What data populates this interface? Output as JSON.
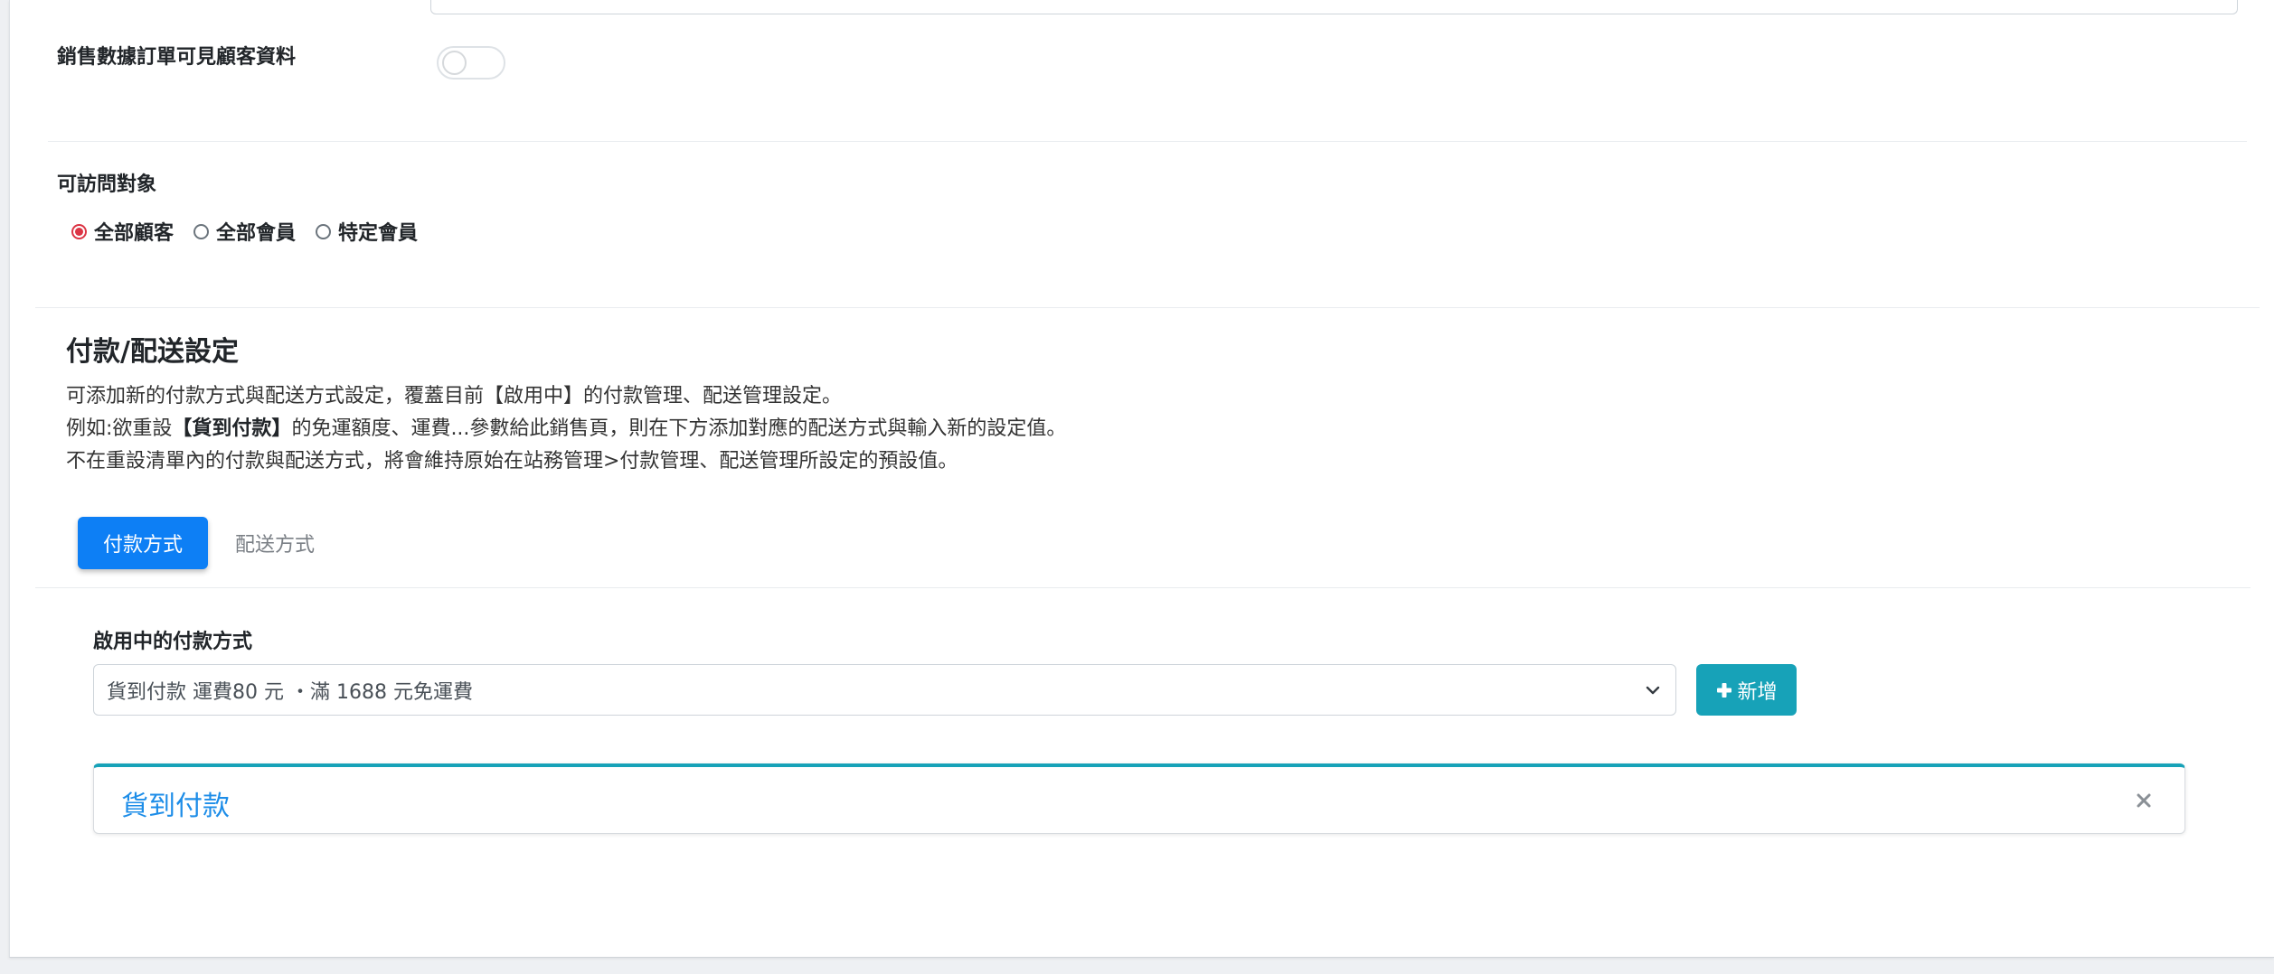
{
  "settings": {
    "sales_order_customer_visible": {
      "label": "銷售數據訂單可見顧客資料",
      "enabled": false
    }
  },
  "access": {
    "label": "可訪問對象",
    "options": [
      {
        "label": "全部顧客",
        "checked": true
      },
      {
        "label": "全部會員",
        "checked": false
      },
      {
        "label": "特定會員",
        "checked": false
      }
    ]
  },
  "payment_shipping": {
    "title": "付款/配送設定",
    "desc_line1": "可添加新的付款方式與配送方式設定，覆蓋目前【啟用中】的付款管理、配送管理設定。",
    "desc_line2_prefix": "例如:欲重設",
    "desc_line2_bold": "【貨到付款】",
    "desc_line2_suffix": "的免運額度、運費...參數給此銷售頁，則在下方添加對應的配送方式與輸入新的設定值。",
    "desc_line3": "不在重設清單內的付款與配送方式，將會維持原始在站務管理>付款管理、配送管理所設定的預設值。",
    "tabs": [
      {
        "label": "付款方式",
        "active": true
      },
      {
        "label": "配送方式",
        "active": false
      }
    ],
    "active_methods_label": "啟用中的付款方式",
    "select_value": "貨到付款 運費80 元 ・滿 1688 元免運費",
    "add_button": "新增",
    "panel_title": "貨到付款"
  },
  "colors": {
    "primary": "#0d7ff5",
    "info": "#17a2b8",
    "radio_checked": "#dc3545",
    "panel_title": "#1d8de8"
  },
  "icons": {
    "select": "chevron-down-icon",
    "add": "plus-icon",
    "panel": "close-icon"
  }
}
